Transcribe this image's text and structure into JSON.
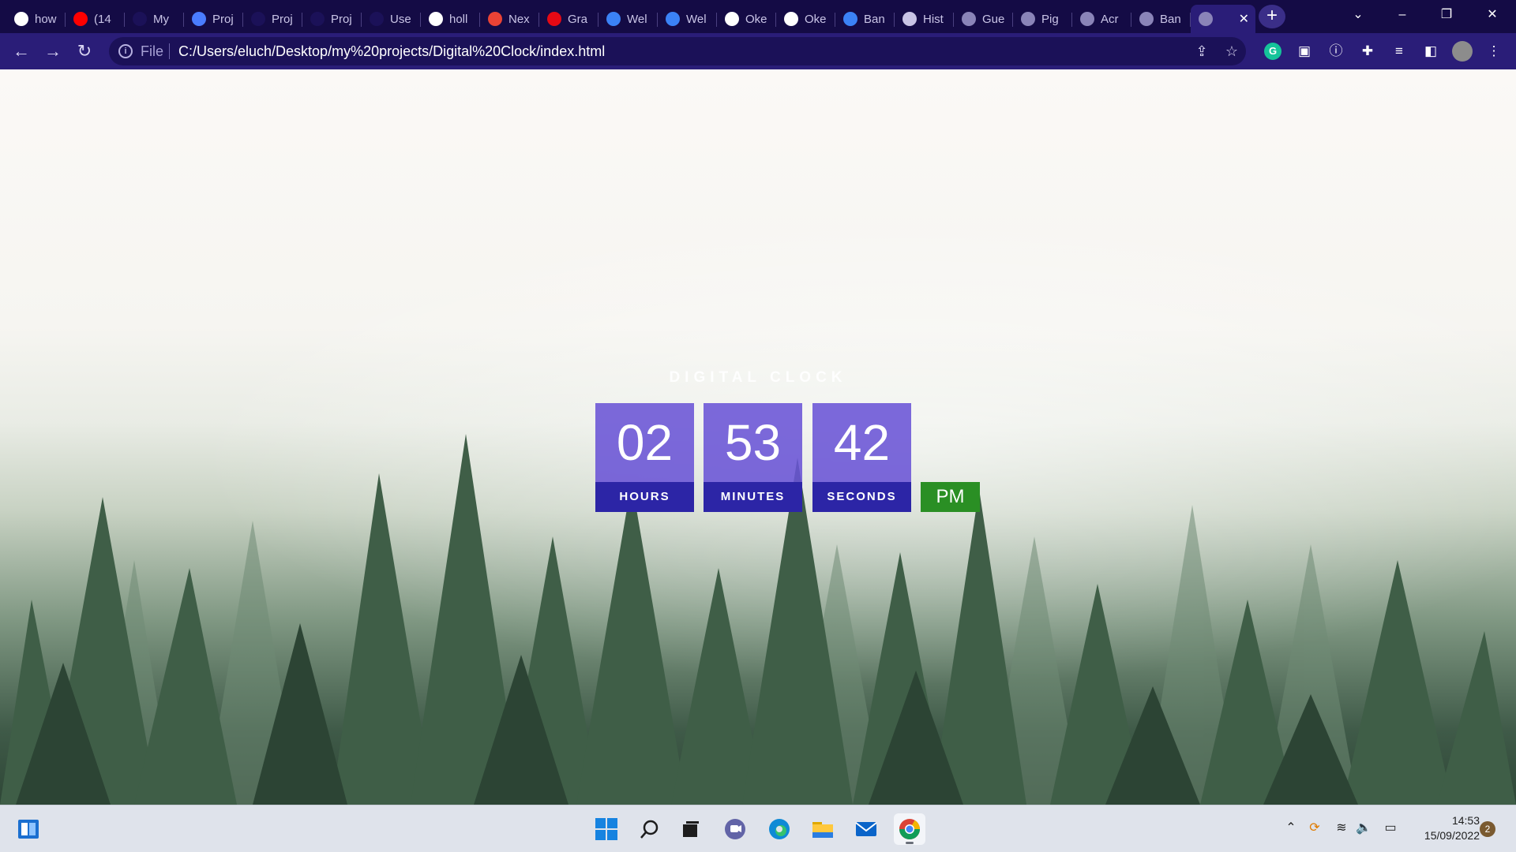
{
  "browser": {
    "tabs": [
      {
        "title": "how",
        "icon": "google-icon",
        "color": "#ffffff"
      },
      {
        "title": "(14",
        "icon": "youtube-icon",
        "color": "#ff0000"
      },
      {
        "title": "My",
        "icon": "alx-icon",
        "color": "#1b1158"
      },
      {
        "title": "Proj",
        "icon": "loading-icon",
        "color": "#4a7cff"
      },
      {
        "title": "Proj",
        "icon": "alx-icon",
        "color": "#1b1158"
      },
      {
        "title": "Proj",
        "icon": "alx-icon",
        "color": "#1b1158"
      },
      {
        "title": "Use",
        "icon": "alx-icon",
        "color": "#1b1158"
      },
      {
        "title": "holl",
        "icon": "github-icon",
        "color": "#ffffff"
      },
      {
        "title": "Nex",
        "icon": "gmail-icon",
        "color": "#ea4335"
      },
      {
        "title": "Gra",
        "icon": "netflix-icon",
        "color": "#e50914"
      },
      {
        "title": "Wel",
        "icon": "gear-badge-icon",
        "color": "#3b82f6"
      },
      {
        "title": "Wel",
        "icon": "gear-badge-icon",
        "color": "#3b82f6"
      },
      {
        "title": "Oke",
        "icon": "github-icon",
        "color": "#ffffff"
      },
      {
        "title": "Oke",
        "icon": "github-icon",
        "color": "#ffffff"
      },
      {
        "title": "Ban",
        "icon": "c-logo-icon",
        "color": "#3b82f6"
      },
      {
        "title": "Hist",
        "icon": "history-icon",
        "color": "#c9c4e6"
      },
      {
        "title": "Gue",
        "icon": "globe-icon",
        "color": "#8a84b8"
      },
      {
        "title": "Pig",
        "icon": "globe-icon",
        "color": "#8a84b8"
      },
      {
        "title": "Acr",
        "icon": "globe-icon",
        "color": "#8a84b8"
      },
      {
        "title": "Ban",
        "icon": "globe-icon",
        "color": "#8a84b8"
      },
      {
        "title": "",
        "icon": "globe-icon",
        "color": "#8a84b8",
        "active": true
      }
    ],
    "address": {
      "scheme_label": "File",
      "url": "C:/Users/eluch/Desktop/my%20projects/Digital%20Clock/index.html"
    }
  },
  "clock": {
    "title": "DIGITAL CLOCK",
    "hours": {
      "value": "02",
      "label": "HOURS"
    },
    "minutes": {
      "value": "53",
      "label": "MINUTES"
    },
    "seconds": {
      "value": "42",
      "label": "SECONDS"
    },
    "period": "PM"
  },
  "taskbar": {
    "time": "14:53",
    "date": "15/09/2022",
    "notifications": "2"
  }
}
